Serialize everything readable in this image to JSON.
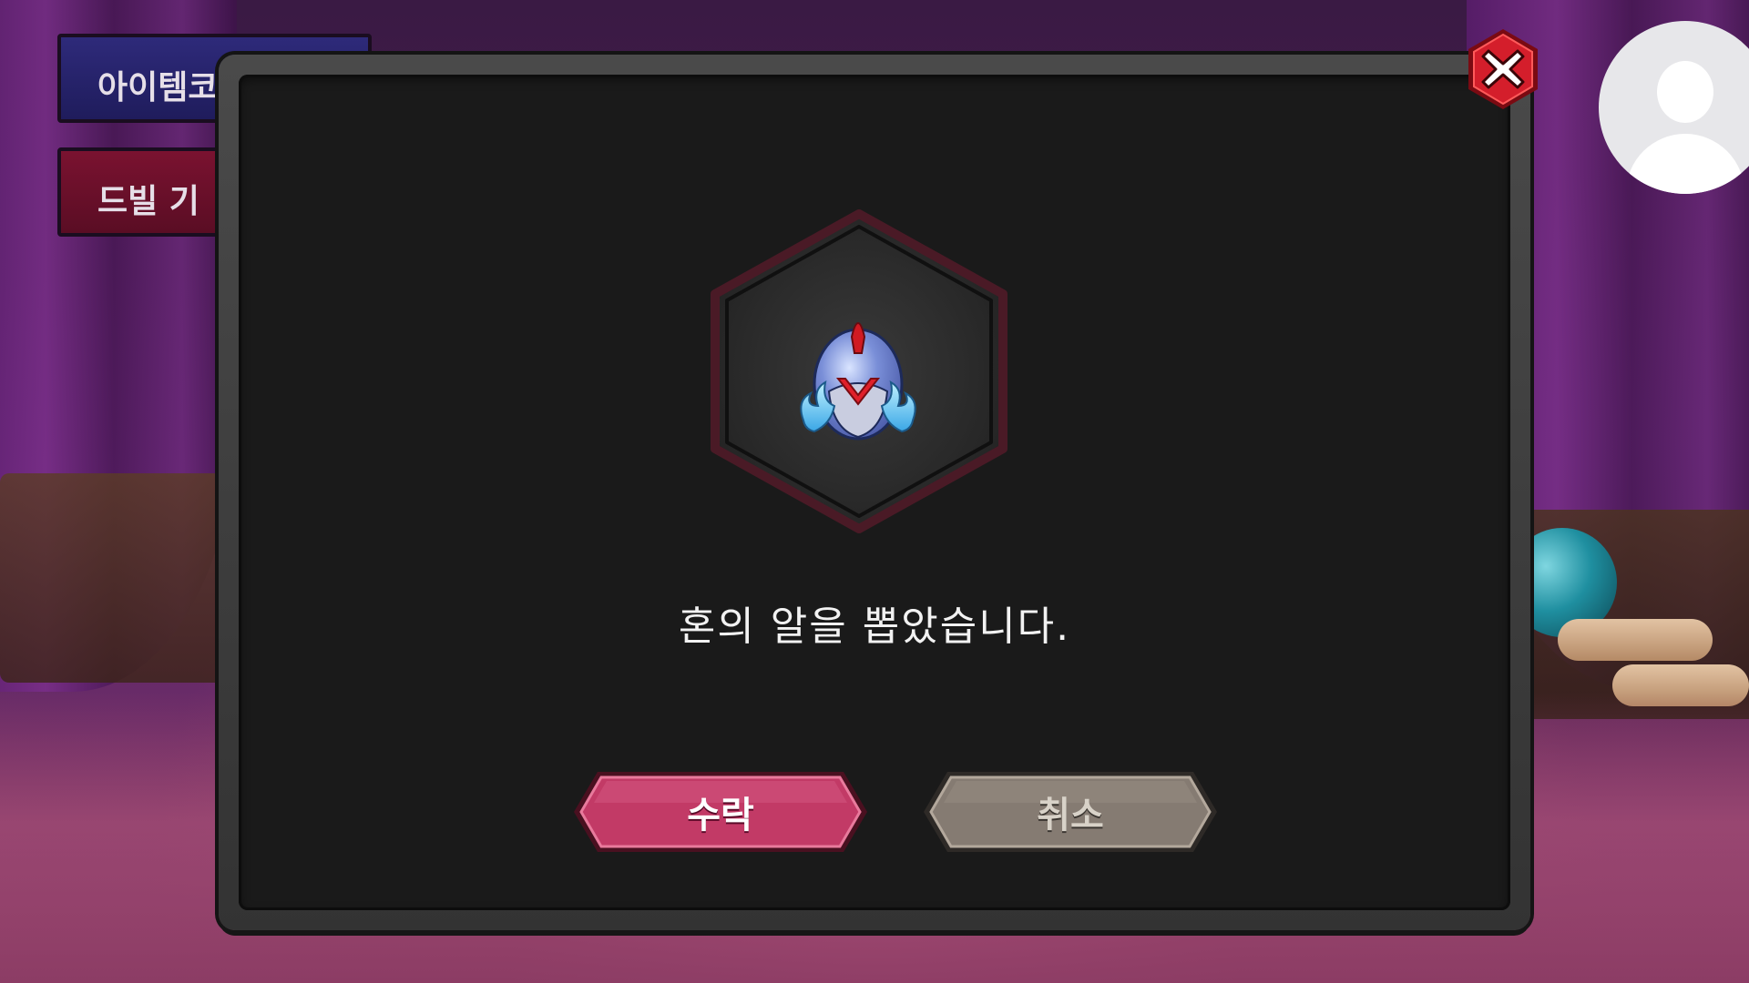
{
  "background": {
    "menu": {
      "item_code_label": "아이템코",
      "devil_label": "드빌 기"
    }
  },
  "dialog": {
    "message": "혼의 알을 뽑았습니다.",
    "accept_label": "수락",
    "cancel_label": "취소",
    "item_icon": "soul-egg-icon",
    "close_icon": "close-x-icon"
  },
  "colors": {
    "accept": "#c23a66",
    "cancel": "#857b72",
    "close": "#d41e2b",
    "hex_border": "#4a1a26"
  }
}
